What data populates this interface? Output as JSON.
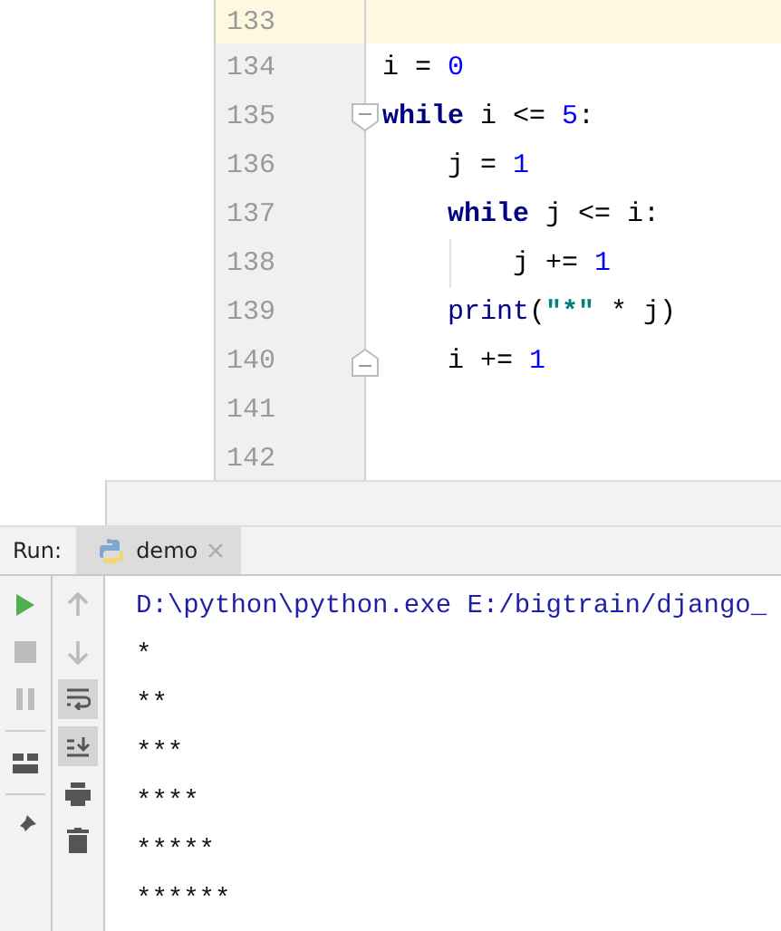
{
  "editor": {
    "lines": [
      {
        "number": "133",
        "current": true
      },
      {
        "number": "134",
        "current": false,
        "tokens": [
          {
            "kind": "name",
            "text": "i"
          },
          {
            "kind": "plain",
            "text": " = "
          },
          {
            "kind": "number",
            "text": "0"
          }
        ]
      },
      {
        "number": "135",
        "current": false,
        "tokens": [
          {
            "kind": "keyword",
            "text": "while"
          },
          {
            "kind": "plain",
            "text": " i <= "
          },
          {
            "kind": "number",
            "text": "5"
          },
          {
            "kind": "plain",
            "text": ":"
          }
        ],
        "children": [
          {
            "number": "136",
            "current": false,
            "tokens": [
              {
                "kind": "name",
                "text": "j"
              },
              {
                "kind": "plain",
                "text": " = "
              },
              {
                "kind": "number",
                "text": "1"
              }
            ]
          },
          {
            "number": "137",
            "current": false,
            "tokens": [
              {
                "kind": "keyword",
                "text": "while"
              },
              {
                "kind": "plain",
                "text": " j <= i:"
              }
            ],
            "children": [
              {
                "number": "138",
                "current": false,
                "tokens": [
                  {
                    "kind": "name",
                    "text": "j"
                  },
                  {
                    "kind": "plain",
                    "text": " += "
                  },
                  {
                    "kind": "number",
                    "text": "1"
                  }
                ]
              }
            ]
          },
          {
            "number": "139",
            "current": false,
            "tokens": [
              {
                "kind": "builtin",
                "text": "print"
              },
              {
                "kind": "plain",
                "text": "("
              },
              {
                "kind": "string",
                "text": "\"*\""
              },
              {
                "kind": "plain",
                "text": " * j)"
              }
            ]
          },
          {
            "number": "140",
            "current": false,
            "tokens": [
              {
                "kind": "name",
                "text": "i"
              },
              {
                "kind": "plain",
                "text": " += "
              },
              {
                "kind": "number",
                "text": "1"
              }
            ]
          }
        ]
      },
      {
        "number": "141",
        "current": false
      },
      {
        "number": "142",
        "current": false
      }
    ]
  },
  "run_panel": {
    "label": "Run:",
    "tabs": [
      {
        "label": "demo",
        "selected": true
      }
    ],
    "right_toolbar": [
      {
        "on": false
      },
      {
        "on": false
      },
      {
        "on": true
      },
      {
        "on": true
      },
      {
        "on": false
      },
      {
        "on": false
      }
    ],
    "console": [
      {
        "kind": "command",
        "text": "D:\\python\\python.exe E:/bigtrain/django_"
      },
      {
        "kind": "output",
        "text": "*"
      },
      {
        "kind": "output",
        "text": "**"
      },
      {
        "kind": "output",
        "text": "***"
      },
      {
        "kind": "output",
        "text": "****"
      },
      {
        "kind": "output",
        "text": "*****"
      },
      {
        "kind": "output",
        "text": "******"
      }
    ]
  }
}
